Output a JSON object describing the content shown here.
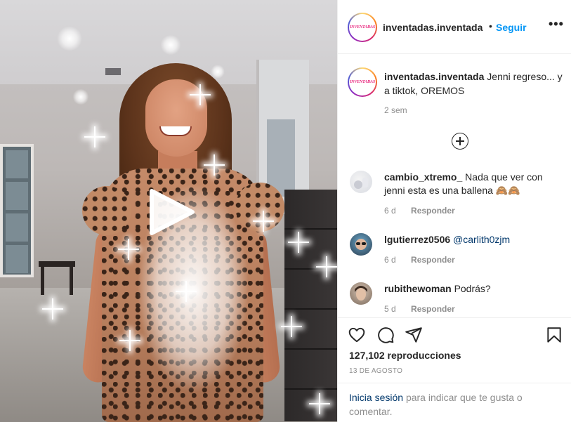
{
  "post": {
    "username": "inventadas.inventada",
    "avatar_logo_text": "INVENTADAS",
    "header_separator": "•",
    "follow_label": "Seguir",
    "more_icon": "more-dots-icon",
    "caption_text": "Jenni regreso... y a tiktok, OREMOS",
    "caption_time": "2 sem",
    "load_more_icon": "plus-circle-icon",
    "play_icon": "play-icon",
    "views": "127,102 reproducciones",
    "date": "13 DE AGOSTO"
  },
  "comments": [
    {
      "username": "cambio_xtremo_",
      "text": "Nada que ver con jenni esta es una ballena",
      "emoji": "🙈🙈",
      "time": "6 d",
      "reply_label": "Responder"
    },
    {
      "username": "lgutierrez0506",
      "mention": "@carlith0zjm",
      "time": "6 d",
      "reply_label": "Responder"
    },
    {
      "username": "rubithewoman",
      "text": "Podrás?",
      "time": "5 d",
      "reply_label": "Responder"
    }
  ],
  "actions": {
    "like_icon": "heart-icon",
    "comment_icon": "comment-icon",
    "share_icon": "share-icon",
    "save_icon": "bookmark-icon"
  },
  "login_prompt": {
    "link": "Inicia sesión",
    "text": "para indicar que te gusta o comentar."
  },
  "colors": {
    "link_blue": "#0095f6",
    "mention_blue": "#00376b",
    "meta_gray": "#8e8e8e",
    "text": "#262626",
    "divider": "#efefef"
  }
}
